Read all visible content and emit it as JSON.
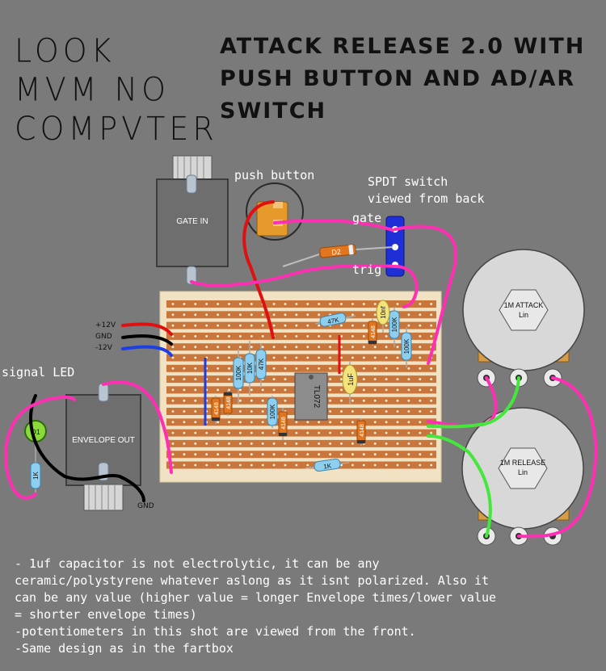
{
  "title": "ATTACK RELEASE 2.0 WITH PUSH BUTTON AND AD/AR SWITCH",
  "logo": [
    "LOOK",
    "MVM NO",
    "COMPVTER"
  ],
  "labels": {
    "push_button": "push button",
    "spdt_line1": "SPDT switch",
    "spdt_line2": "viewed from back",
    "gate": "gate",
    "trig": "trig",
    "signal_led": "signal LED",
    "gate_in": "GATE IN",
    "envelope_out": "ENVELOPE OUT",
    "gnd": "GND",
    "p12": "+12V",
    "gnd_rail": "GND",
    "m12": "-12V"
  },
  "pots": [
    {
      "name": "1M ATTACK",
      "taper": "Lin"
    },
    {
      "name": "1M RELEASE",
      "taper": "Lin"
    }
  ],
  "components": {
    "r47k_top": "47K",
    "r100k_right1": "100K",
    "r100k_right2": "100K",
    "c10nf": "10nf",
    "d4148_top": "4148",
    "r100k_left": "100K",
    "r10k": "10K",
    "r47k_left": "47K",
    "d4148_a": "4148",
    "d4148_b": "4148",
    "r100k_mid": "100K",
    "d4148_mid": "4148",
    "ic": "TL072",
    "c1uf": "1uF",
    "d4148_right": "4148",
    "r1k_board": "1K",
    "r1k_led": "1K",
    "d1": "D1",
    "d2": "D2"
  },
  "colors": {
    "background": "#7a7a7a",
    "stripboard": "#f1e2c3",
    "copper_strip": "#c9763d",
    "jack_body": "#6e6e6e",
    "wire_magenta": "#ff2fb4",
    "wire_red": "#e01010",
    "wire_black": "#000000",
    "wire_blue": "#1b3fe0",
    "wire_green": "#44e83a",
    "led_green": "#8dd83a",
    "switch_blue": "#1f2fd6",
    "pot_body": "#d8d8d8"
  },
  "notes": "- 1uf capacitor is not electrolytic, it can be any\nceramic/polystyrene whatever aslong as it isnt polarized. Also it\ncan be any value (higher value = longer Envelope times/lower value\n= shorter envelope times)\n-potentiometers in this shot are viewed from the front.\n-Same design as in the fartbox"
}
